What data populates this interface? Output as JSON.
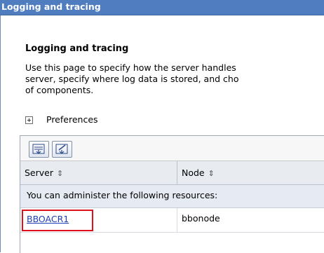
{
  "window": {
    "title": "Logging and tracing"
  },
  "page": {
    "heading": "Logging and tracing",
    "description_lines": [
      "Use this page to specify how the server handles",
      "server, specify where log data is stored, and cho",
      "of components."
    ],
    "preferences_label": "Preferences"
  },
  "toolbar": {
    "buttons": [
      {
        "name": "select-all-icon"
      },
      {
        "name": "deselect-all-icon"
      }
    ]
  },
  "table": {
    "columns": [
      {
        "label": "Server",
        "sort_icon": "⇕"
      },
      {
        "label": "Node",
        "sort_icon": "⇕"
      }
    ],
    "info_message": "You can administer the following resources:",
    "rows": [
      {
        "server": "BBOACR1",
        "node": "bbonode"
      }
    ]
  },
  "colors": {
    "title_bar": "#4f7dc0",
    "link": "#1f3fb6",
    "highlight": "#e0101b"
  }
}
